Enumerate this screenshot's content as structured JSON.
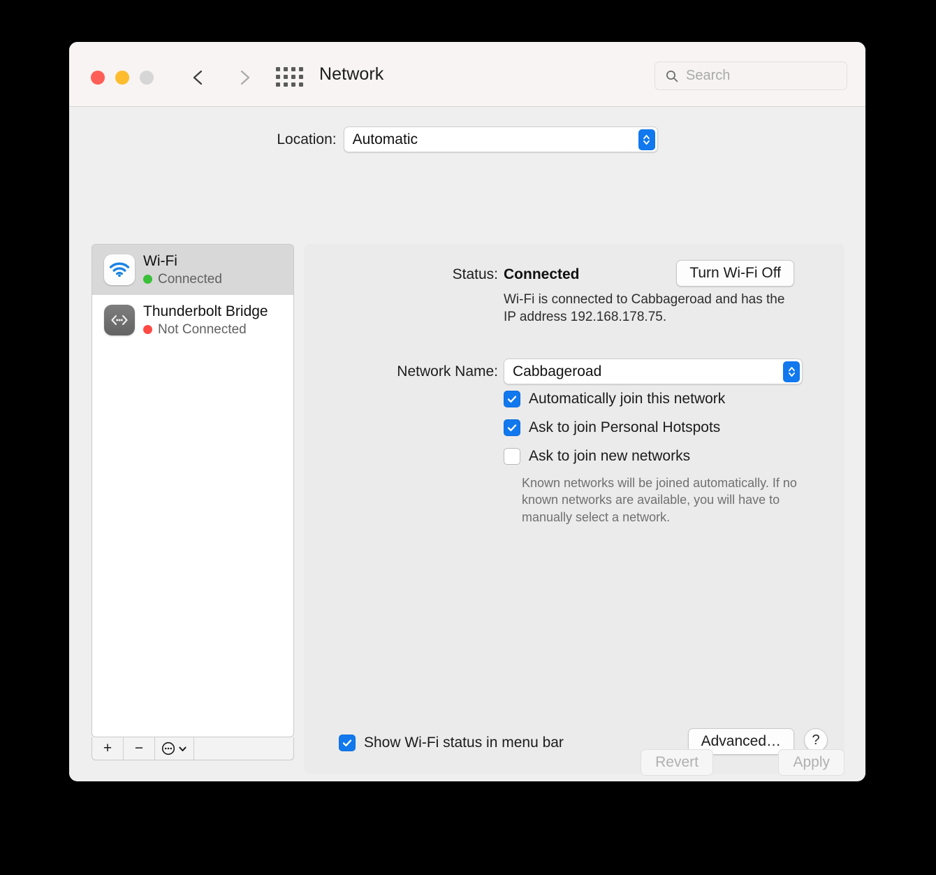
{
  "window": {
    "title": "Network"
  },
  "toolbar": {
    "back_icon": "chevron-left-icon",
    "forward_icon": "chevron-right-icon",
    "grid_icon": "show-all-grid-icon",
    "search": {
      "placeholder": "Search",
      "value": "",
      "icon": "search-icon"
    }
  },
  "location": {
    "label": "Location:",
    "value": "Automatic",
    "options": [
      "Automatic"
    ]
  },
  "sidebar": {
    "services": [
      {
        "name": "Wi-Fi",
        "status": "Connected",
        "status_color": "#3ac03a",
        "icon": "wifi-icon",
        "selected": true
      },
      {
        "name": "Thunderbolt Bridge",
        "status": "Not Connected",
        "status_color": "#ff4b44",
        "icon": "thunderbolt-bridge-icon",
        "selected": false
      }
    ],
    "toolbar": {
      "add_label": "+",
      "remove_label": "−",
      "actions_icon": "ellipsis-circle-icon",
      "actions_chevron": "chevron-down-icon"
    }
  },
  "panel": {
    "status_label": "Status:",
    "status_value": "Connected",
    "turn_off_button": "Turn Wi-Fi Off",
    "status_detail": "Wi-Fi is connected to Cabbageroad and has the IP address 192.168.178.75.",
    "network_name_label": "Network Name:",
    "network_name_value": "Cabbageroad",
    "network_name_options": [
      "Cabbageroad"
    ],
    "checkboxes": [
      {
        "label": "Automatically join this network",
        "checked": true
      },
      {
        "label": "Ask to join Personal Hotspots",
        "checked": true
      },
      {
        "label": "Ask to join new networks",
        "checked": false
      }
    ],
    "known_networks_note": "Known networks will be joined automatically. If no known networks are available, you will have to manually select a network.",
    "menu_bar_checkbox": {
      "label": "Show Wi-Fi status in menu bar",
      "checked": true
    },
    "advanced_button": "Advanced…",
    "help_button": "?"
  },
  "footer": {
    "revert_button": "Revert",
    "apply_button": "Apply",
    "revert_enabled": false,
    "apply_enabled": false
  },
  "colors": {
    "accent": "#1178ee",
    "connected": "#3ac03a",
    "not_connected": "#ff4b44",
    "toolbar_bg": "#f7f4f3",
    "content_bg": "#efefef",
    "panel_bg": "#ebebeb"
  }
}
